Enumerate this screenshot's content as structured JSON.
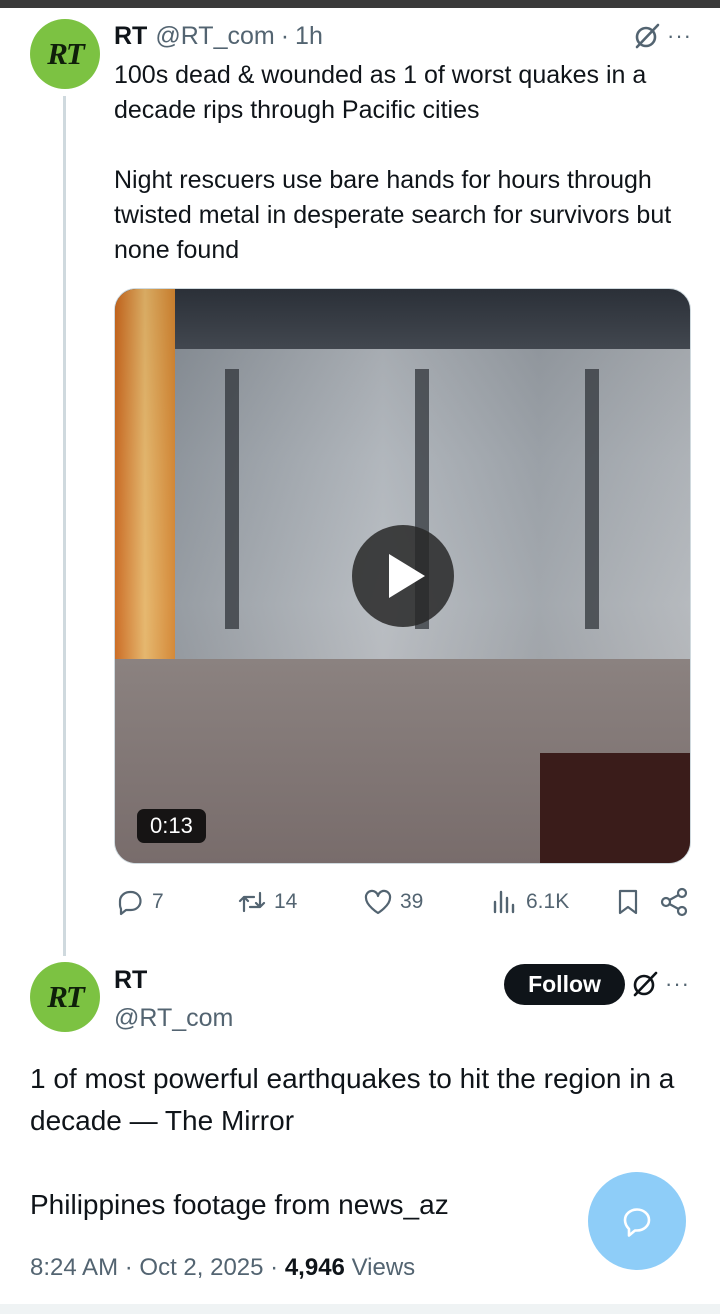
{
  "tweet1": {
    "avatar_text": "RT",
    "name": "RT",
    "handle": "@RT_com",
    "separator": "·",
    "time": "1h",
    "text_p1": "100s dead & wounded as 1 of worst quakes in a decade rips through Pacific cities",
    "text_p2": "Night rescuers use bare hands for hours through twisted metal in desperate search for survivors but none found",
    "video_duration": "0:13",
    "actions": {
      "replies": "7",
      "reposts": "14",
      "likes": "39",
      "views": "6.1K"
    }
  },
  "tweet2": {
    "avatar_text": "RT",
    "name": "RT",
    "handle": "@RT_com",
    "follow_label": "Follow",
    "text_p1": "1 of most powerful earthquakes to hit the region in a decade — The Mirror",
    "text_p2": "Philippines footage from news_az",
    "time": "8:24 AM",
    "sep1": "·",
    "date": "Oct 2, 2025",
    "sep2": "·",
    "views_count": "4,946",
    "views_label": "Views"
  },
  "more_label": "···",
  "colors": {
    "avatar_bg": "#7cc242",
    "secondary_text": "#536471",
    "follow_bg": "#0f1419",
    "fab_bg": "#8ecdf8"
  }
}
